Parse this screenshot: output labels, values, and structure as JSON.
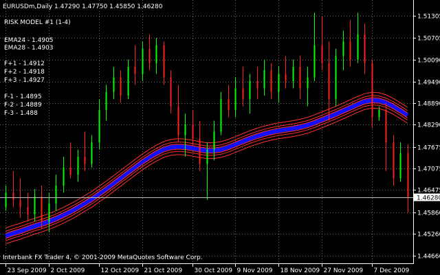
{
  "header": {
    "symbol_line": "EURUSDm,Daily  1.47290 1.47750 1.45850 1.46280",
    "model": "RISK MODEL #1 (1-4)"
  },
  "indicators": [
    "EMA24 - 1.4905",
    "EMA28 - 1.4903",
    "",
    "F+1 - 1.4912",
    "F+2 - 1.4918",
    "F+3 - 1.4927",
    "",
    "F-1 - 1.4895",
    "F-2 - 1.4889",
    "F-3 - 1.488"
  ],
  "footer": "Interbank FX Trader 4, © 2001-2009 MetaQuotes Software Corp.",
  "current_price": "1.46280",
  "colors": {
    "background": "#000000",
    "bull": "#00ff00",
    "bear": "#ff2020",
    "grid": "#6f6f6f",
    "ema": "#1010ff",
    "band": "#ff3030"
  },
  "chart_data": {
    "type": "candlestick",
    "ylim": [
      1.4446,
      1.516
    ],
    "y_ticks": [
      "1.51305",
      "1.50705",
      "1.50090",
      "1.49490",
      "1.48890",
      "1.48290",
      "1.47675",
      "1.47075",
      "1.46475",
      "1.45860",
      "1.45260",
      "1.44660"
    ],
    "x_ticks": [
      "23 Sep 2009",
      "2 Oct 2009",
      "12 Oct 2009",
      "21 Oct 2009",
      "30 Oct 2009",
      "9 Nov 2009",
      "18 Nov 2009",
      "27 Nov 2009",
      "7 Dec 2009"
    ],
    "ohlc": [
      [
        1.46,
        1.466,
        1.459,
        1.464
      ],
      [
        1.464,
        1.47,
        1.46,
        1.462
      ],
      [
        1.462,
        1.468,
        1.457,
        1.46
      ],
      [
        1.46,
        1.464,
        1.456,
        1.458
      ],
      [
        1.458,
        1.465,
        1.456,
        1.463
      ],
      [
        1.463,
        1.466,
        1.454,
        1.456
      ],
      [
        1.456,
        1.464,
        1.453,
        1.461
      ],
      [
        1.461,
        1.469,
        1.459,
        1.466
      ],
      [
        1.466,
        1.474,
        1.464,
        1.471
      ],
      [
        1.471,
        1.478,
        1.468,
        1.469
      ],
      [
        1.469,
        1.476,
        1.467,
        1.474
      ],
      [
        1.474,
        1.481,
        1.47,
        1.472
      ],
      [
        1.472,
        1.48,
        1.471,
        1.478
      ],
      [
        1.478,
        1.49,
        1.476,
        1.487
      ],
      [
        1.487,
        1.494,
        1.484,
        1.492
      ],
      [
        1.492,
        1.499,
        1.49,
        1.496
      ],
      [
        1.496,
        1.498,
        1.489,
        1.491
      ],
      [
        1.491,
        1.501,
        1.49,
        1.499
      ],
      [
        1.499,
        1.505,
        1.494,
        1.497
      ],
      [
        1.497,
        1.506,
        1.495,
        1.504
      ],
      [
        1.504,
        1.508,
        1.498,
        1.5
      ],
      [
        1.5,
        1.507,
        1.497,
        1.505
      ],
      [
        1.505,
        1.506,
        1.494,
        1.496
      ],
      [
        1.496,
        1.498,
        1.486,
        1.488
      ],
      [
        1.488,
        1.494,
        1.478,
        1.48
      ],
      [
        1.48,
        1.486,
        1.474,
        1.483
      ],
      [
        1.483,
        1.487,
        1.477,
        1.479
      ],
      [
        1.479,
        1.484,
        1.47,
        1.472
      ],
      [
        1.472,
        1.478,
        1.462,
        1.476
      ],
      [
        1.476,
        1.484,
        1.473,
        1.481
      ],
      [
        1.481,
        1.492,
        1.48,
        1.49
      ],
      [
        1.49,
        1.494,
        1.485,
        1.487
      ],
      [
        1.487,
        1.496,
        1.485,
        1.493
      ],
      [
        1.493,
        1.499,
        1.488,
        1.49
      ],
      [
        1.49,
        1.497,
        1.486,
        1.495
      ],
      [
        1.495,
        1.499,
        1.49,
        1.493
      ],
      [
        1.493,
        1.501,
        1.491,
        1.498
      ],
      [
        1.498,
        1.5,
        1.49,
        1.492
      ],
      [
        1.492,
        1.499,
        1.489,
        1.497
      ],
      [
        1.497,
        1.502,
        1.493,
        1.495
      ],
      [
        1.495,
        1.501,
        1.493,
        1.499
      ],
      [
        1.499,
        1.502,
        1.49,
        1.493
      ],
      [
        1.493,
        1.499,
        1.488,
        1.496
      ],
      [
        1.496,
        1.514,
        1.495,
        1.505
      ],
      [
        1.505,
        1.513,
        1.498,
        1.5
      ],
      [
        1.5,
        1.506,
        1.484,
        1.49
      ],
      [
        1.49,
        1.504,
        1.488,
        1.502
      ],
      [
        1.502,
        1.509,
        1.498,
        1.506
      ],
      [
        1.506,
        1.512,
        1.499,
        1.501
      ],
      [
        1.501,
        1.514,
        1.5,
        1.508
      ],
      [
        1.508,
        1.511,
        1.497,
        1.5
      ],
      [
        1.5,
        1.501,
        1.482,
        1.485
      ],
      [
        1.485,
        1.488,
        1.484,
        1.487
      ],
      [
        1.487,
        1.489,
        1.47,
        1.478
      ],
      [
        1.478,
        1.48,
        1.466,
        1.468
      ],
      [
        1.468,
        1.478,
        1.467,
        1.475
      ],
      [
        1.475,
        1.4775,
        1.4585,
        1.4628
      ]
    ],
    "ema": [
      1.452,
      1.4527,
      1.4533,
      1.454,
      1.4547,
      1.4553,
      1.456,
      1.4568,
      1.4577,
      1.4587,
      1.4598,
      1.461,
      1.4622,
      1.4636,
      1.465,
      1.4665,
      1.468,
      1.4695,
      1.471,
      1.4725,
      1.4738,
      1.475,
      1.476,
      1.4766,
      1.4768,
      1.4767,
      1.4764,
      1.476,
      1.4757,
      1.4757,
      1.476,
      1.4766,
      1.4774,
      1.4782,
      1.479,
      1.4797,
      1.4803,
      1.4808,
      1.4812,
      1.4815,
      1.4818,
      1.4822,
      1.4827,
      1.4834,
      1.4842,
      1.485,
      1.4858,
      1.4867,
      1.4876,
      1.4885,
      1.4893,
      1.4897,
      1.4896,
      1.489,
      1.488,
      1.4868,
      1.4855
    ],
    "band_offsets": [
      0.0007,
      0.0013,
      0.0022
    ]
  }
}
